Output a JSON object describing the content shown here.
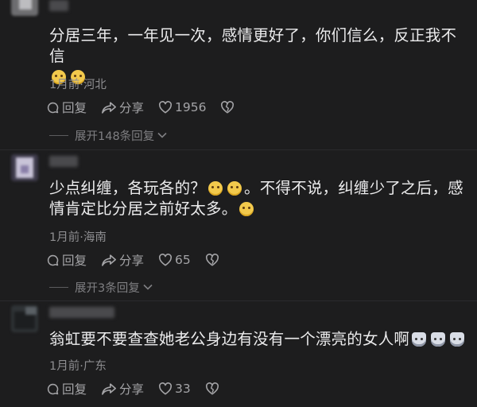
{
  "comments": [
    {
      "text_part1": "分居三年，一年见一次，感情更好了，你们信么，反正我不信",
      "emoji": "grinning-face-emoji",
      "meta": "1月前·河北",
      "reply_label": "回复",
      "share_label": "分享",
      "likes": "1956",
      "expand_label": "展开148条回复"
    },
    {
      "text_part1": "少点纠缠，各玩各的？",
      "text_part2": "。不得不说，纠缠少了之后，感情肯定比分居之前好太多。",
      "emoji": "thinking-face-emoji",
      "meta": "1月前·海南",
      "reply_label": "回复",
      "share_label": "分享",
      "likes": "65",
      "expand_label": "展开3条回复"
    },
    {
      "text_part1": "翁虹要不要查查她老公身边有没有一个漂亮的女人啊",
      "emoji": "cat-face-emoji",
      "meta": "1月前·广东",
      "reply_label": "回复",
      "share_label": "分享",
      "likes": "33"
    }
  ]
}
